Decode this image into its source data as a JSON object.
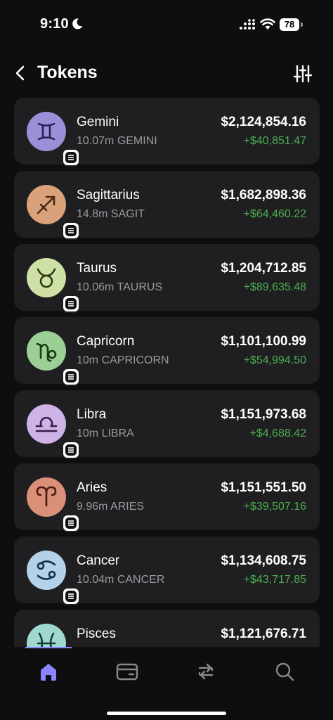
{
  "status_bar": {
    "time": "9:10",
    "battery_level": "78"
  },
  "header": {
    "title": "Tokens"
  },
  "colors": {
    "background": "#0e0e0f",
    "card": "#1f1f21",
    "positive": "#4caf50",
    "muted": "#9a9a9e",
    "accent": "#8c83ff"
  },
  "tokens": [
    {
      "name": "Gemini",
      "amount": "10.07m GEMINI",
      "value": "$2,124,854.16",
      "change": "+$40,851.47",
      "icon": "gemini-icon",
      "color": "#9c8fd8"
    },
    {
      "name": "Sagittarius",
      "amount": "14.8m SAGIT",
      "value": "$1,682,898.36",
      "change": "+$64,460.22",
      "icon": "sagittarius-icon",
      "color": "#d9a27a"
    },
    {
      "name": "Taurus",
      "amount": "10.06m TAURUS",
      "value": "$1,204,712.85",
      "change": "+$89,635.48",
      "icon": "taurus-icon",
      "color": "#cfe0a6"
    },
    {
      "name": "Capricorn",
      "amount": "10m CAPRICORN",
      "value": "$1,101,100.99",
      "change": "+$54,994.50",
      "icon": "capricorn-icon",
      "color": "#9ccf96"
    },
    {
      "name": "Libra",
      "amount": "10m LIBRA",
      "value": "$1,151,973.68",
      "change": "+$4,688.42",
      "icon": "libra-icon",
      "color": "#cdb3e6"
    },
    {
      "name": "Aries",
      "amount": "9.96m ARIES",
      "value": "$1,151,551.50",
      "change": "+$39,507.16",
      "icon": "aries-icon",
      "color": "#d98f78"
    },
    {
      "name": "Cancer",
      "amount": "10.04m CANCER",
      "value": "$1,134,608.75",
      "change": "+$43,717.85",
      "icon": "cancer-icon",
      "color": "#b3d2ea"
    },
    {
      "name": "Pisces",
      "amount": "",
      "value": "$1,121,676.71",
      "change": "",
      "icon": "pisces-icon",
      "color": "#9fd8cf"
    }
  ],
  "tab_bar": {
    "tabs": [
      {
        "name": "home",
        "icon": "home-icon",
        "active": true
      },
      {
        "name": "cards",
        "icon": "card-icon",
        "active": false
      },
      {
        "name": "swap",
        "icon": "swap-icon",
        "active": false
      },
      {
        "name": "search",
        "icon": "search-icon",
        "active": false
      }
    ]
  }
}
